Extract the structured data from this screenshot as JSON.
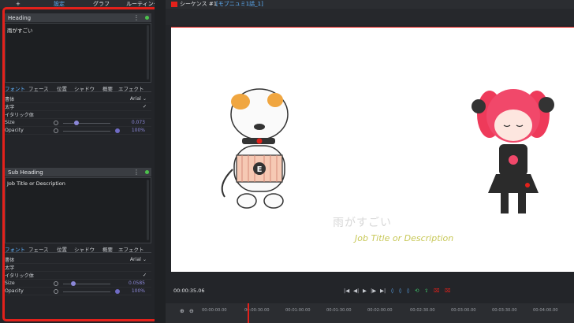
{
  "top_tabs": [
    {
      "label": "+",
      "icon": "plus-icon"
    },
    {
      "label": "設定",
      "active": true
    },
    {
      "label": "グラフ"
    },
    {
      "label": "ルーティング"
    }
  ],
  "heading_panel": {
    "title": "Heading",
    "text": "雨がすごい",
    "tabs": [
      "フォント",
      "フェース",
      "位置",
      "シャドウ",
      "概要",
      "エフェクト"
    ],
    "active_tab": "フォント",
    "rows": {
      "typeface_label": "書体",
      "typeface_value": "Arial",
      "bold_label": "太字",
      "italic_label": "イタリック体",
      "size_label": "Size",
      "size_value": "0.073",
      "opacity_label": "Opacity",
      "opacity_value": "100%"
    }
  },
  "subheading_panel": {
    "title": "Sub Heading",
    "text": "Job Title or Description",
    "tabs": [
      "フォント",
      "フェース",
      "位置",
      "シャドウ",
      "概要",
      "エフェクト"
    ],
    "active_tab": "フォント",
    "rows": {
      "typeface_label": "書体",
      "typeface_value": "Arial",
      "bold_label": "太字",
      "italic_label": "イタリック体",
      "size_label": "Size",
      "size_value": "0.0585",
      "opacity_label": "Opacity",
      "opacity_value": "100%"
    }
  },
  "sequence": {
    "label": "シーケンス #1",
    "name": "[モブニュミ1話_1]"
  },
  "viewer": {
    "subtitle_main": "雨がすごい",
    "subtitle_sub": "Job Title or Description"
  },
  "transport": {
    "timecode": "00:00:35.06"
  },
  "timeline": {
    "ticks": [
      "00:00:00.00",
      "00:00:30.00",
      "00:01:00.00",
      "00:01:30.00",
      "00:02:00.00",
      "00:02:30.00",
      "00:03:00.00",
      "00:03:30.00",
      "00:04:00.00"
    ]
  },
  "colors": {
    "accent": "#5fb3ff",
    "highlight_frame": "#e3211b",
    "slider": "#8b87d8"
  }
}
